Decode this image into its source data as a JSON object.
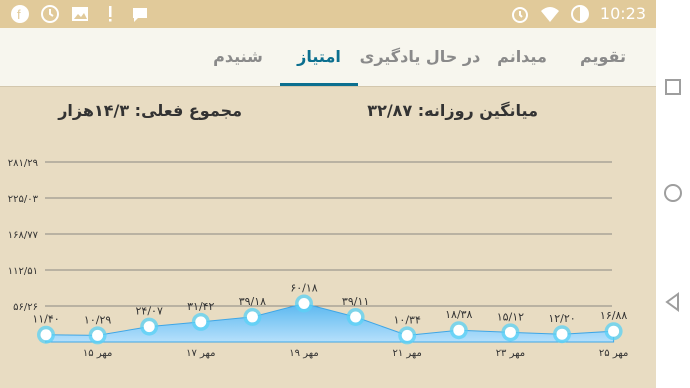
{
  "status_bar": {
    "time": "10:23",
    "left_icons": [
      "facebook-icon",
      "clock-icon",
      "image-icon",
      "exclamation-icon",
      "chat-icon"
    ],
    "right_icons": [
      "alarm-icon",
      "wifi-icon",
      "battery-icon"
    ]
  },
  "tabs": [
    {
      "label": "تقویم",
      "active": false
    },
    {
      "label": "میدانم",
      "active": false
    },
    {
      "label": "در حال یادگیری",
      "active": false
    },
    {
      "label": "امتیاز",
      "active": true
    },
    {
      "label": "شنیدم",
      "active": false
    }
  ],
  "stats": {
    "daily_average": "میانگین روزانه: ۳۲/۸۷",
    "total": "مجموع فعلی: ۱۴/۳هزار"
  },
  "colors": {
    "accent": "#0b6f8f",
    "area_top": "#5bb8f0",
    "area_bottom": "#b6e0fb",
    "point_fill": "#ffffff",
    "point_ring": "#5ad1f5",
    "background": "#e8dcc2"
  },
  "chart_data": {
    "type": "area",
    "ytick_labels": [
      "۲۸۱/۲۹",
      "۲۲۵/۰۳",
      "۱۶۸/۷۷",
      "۱۱۲/۵۱",
      "۵۶/۲۶"
    ],
    "yticks": [
      281.29,
      225.03,
      168.77,
      112.51,
      56.26
    ],
    "ylim": [
      0,
      281.29
    ],
    "xtick_labels": [
      "۱۵ مهر",
      "۱۷ مهر",
      "۱۹ مهر",
      "۲۱ مهر",
      "۲۳ مهر",
      "۲۵ مهر"
    ],
    "xtick_positions": [
      1,
      3,
      5,
      7,
      9,
      11
    ],
    "points": [
      {
        "value": 11.4,
        "label": "۱۱/۴۰"
      },
      {
        "value": 10.29,
        "label": "۱۰/۲۹"
      },
      {
        "value": 24.07,
        "label": "۲۴/۰۷"
      },
      {
        "value": 31.42,
        "label": "۳۱/۴۲"
      },
      {
        "value": 39.18,
        "label": "۳۹/۱۸"
      },
      {
        "value": 60.18,
        "label": "۶۰/۱۸"
      },
      {
        "value": 39.11,
        "label": "۳۹/۱۱"
      },
      {
        "value": 10.34,
        "label": "۱۰/۳۴"
      },
      {
        "value": 18.38,
        "label": "۱۸/۳۸"
      },
      {
        "value": 15.12,
        "label": "۱۵/۱۲"
      },
      {
        "value": 12.2,
        "label": "۱۲/۲۰"
      },
      {
        "value": 16.88,
        "label": "۱۶/۸۸"
      }
    ],
    "grid": true
  },
  "nav_buttons": [
    "recent-apps-icon",
    "home-icon",
    "back-icon"
  ]
}
